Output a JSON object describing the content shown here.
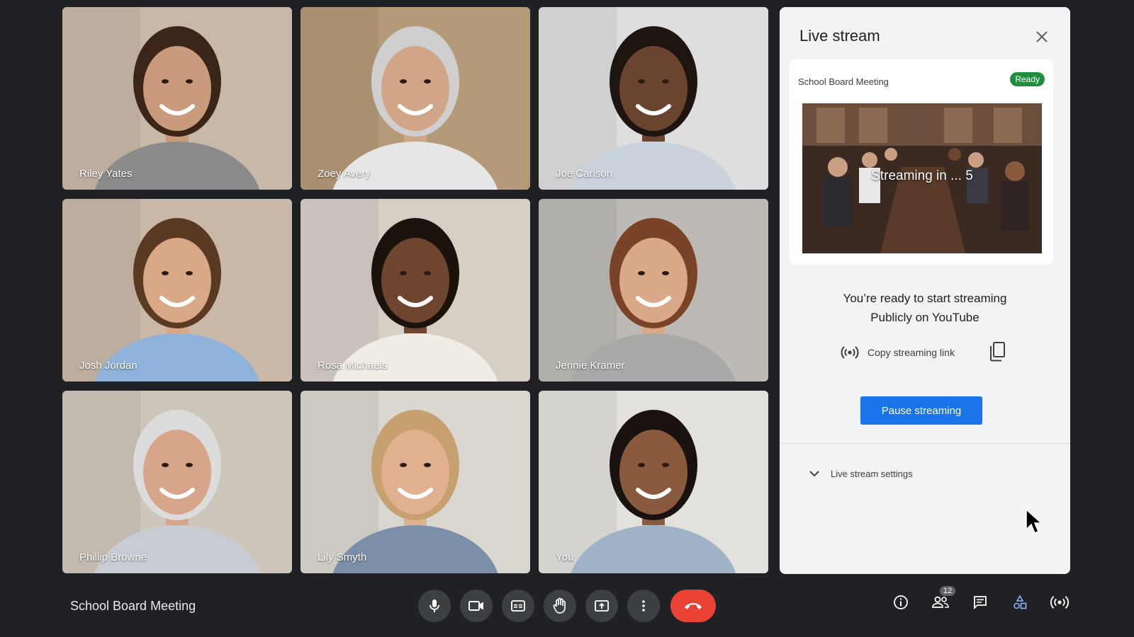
{
  "participants": [
    {
      "name": "Riley Yates",
      "bg": "#c8b8a8",
      "skin": "#c99a7c",
      "hair": "#3b2418",
      "shirt": "#8a8a8a"
    },
    {
      "name": "Zoey Avery",
      "bg": "#b49a78",
      "skin": "#d0a588",
      "hair": "#cfcfcf",
      "shirt": "#e6e6e6"
    },
    {
      "name": "Joe Carlson",
      "bg": "#dedede",
      "skin": "#6b4430",
      "hair": "#1e1410",
      "shirt": "#c9d2dc"
    },
    {
      "name": "Josh Jordan",
      "bg": "#c9b8a8",
      "skin": "#d8a887",
      "hair": "#5a3a22",
      "shirt": "#8fb2da"
    },
    {
      "name": "Rosa Michaels",
      "bg": "#d6cfc6",
      "skin": "#6e4630",
      "hair": "#1c120c",
      "shirt": "#f0ece6"
    },
    {
      "name": "Jennie Kramer",
      "bg": "#bdbab5",
      "skin": "#d9a98a",
      "hair": "#7a4328",
      "shirt": "#a9a9a9"
    },
    {
      "name": "Phillip Browne",
      "bg": "#cfc6bb",
      "skin": "#d6a58a",
      "hair": "#dcdcdc",
      "shirt": "#c7cdd2"
    },
    {
      "name": "Lily Smyth",
      "bg": "#dad6d0",
      "skin": "#e0b08f",
      "hair": "#c7a070",
      "shirt": "#7b8fa8"
    },
    {
      "name": "You",
      "bg": "#e3e1dd",
      "skin": "#8a5a3e",
      "hair": "#1a1210",
      "shirt": "#9fb3c8"
    }
  ],
  "panel": {
    "title": "Live stream",
    "stream_name": "School Board Meeting",
    "status_badge": "Ready",
    "countdown": "Streaming in ... 5",
    "ready_line1": "You’re  ready to start streaming",
    "ready_line2": "Publicly on YouTube",
    "copy_link_label": "Copy streaming link",
    "pause_button": "Pause streaming",
    "settings_label": "Live stream settings"
  },
  "meeting": {
    "title": "School Board Meeting",
    "participant_count": "12"
  },
  "colors": {
    "background": "#202124",
    "accent": "#1a73e8",
    "ready": "#1e8e3e",
    "end_call": "#ea4335"
  },
  "icons": {
    "controls": [
      "mic-icon",
      "camera-icon",
      "captions-icon",
      "raise-hand-icon",
      "present-icon",
      "more-options-icon",
      "end-call-icon"
    ],
    "right": [
      "info-icon",
      "people-icon",
      "chat-icon",
      "activities-icon",
      "live-stream-icon"
    ]
  }
}
